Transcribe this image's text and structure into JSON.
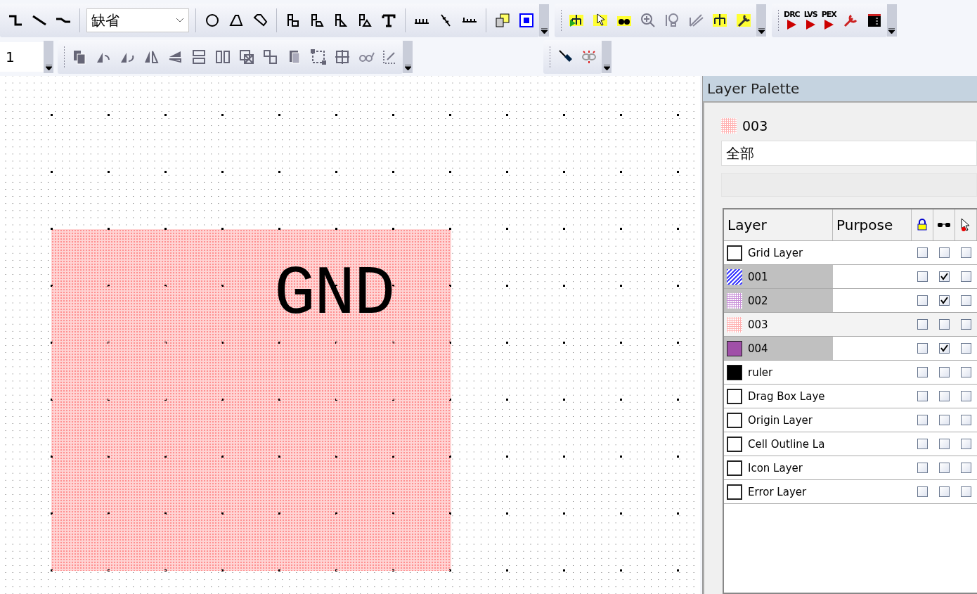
{
  "toolbar": {
    "style_combo": {
      "value": "缺省"
    },
    "width_field": {
      "value": "1"
    },
    "check_buttons": [
      {
        "label": "DRC"
      },
      {
        "label": "LVS"
      },
      {
        "label": "PEX"
      }
    ]
  },
  "canvas": {
    "label": "GND"
  },
  "layer_palette": {
    "title": "Layer Palette",
    "current_layer": {
      "name": "003",
      "kind": "dots",
      "color": "#ffb0b0"
    },
    "filter_combo": {
      "value": "全部"
    },
    "columns": [
      "Layer",
      "Purpose"
    ],
    "layers": [
      {
        "name": "Grid Layer",
        "kind": "outline",
        "color": "#ffffff",
        "selected": false,
        "locked": false,
        "visible": false,
        "selectable": false
      },
      {
        "name": "001",
        "kind": "hatch",
        "color": "#4040ff",
        "selected": true,
        "locked": false,
        "visible": true,
        "selectable": false
      },
      {
        "name": "002",
        "kind": "dots",
        "color": "#c890d8",
        "selected": true,
        "locked": false,
        "visible": true,
        "selectable": false
      },
      {
        "name": "003",
        "kind": "dots",
        "color": "#ffb0b0",
        "selected": false,
        "locked": false,
        "visible": false,
        "selectable": false
      },
      {
        "name": "004",
        "kind": "solid",
        "color": "#a050a8",
        "selected": true,
        "locked": false,
        "visible": true,
        "selectable": false
      },
      {
        "name": "ruler",
        "kind": "solid",
        "color": "#000000",
        "selected": false,
        "locked": false,
        "visible": false,
        "selectable": false
      },
      {
        "name": "Drag Box Laye",
        "kind": "outline",
        "color": "#ffffff",
        "selected": false,
        "locked": false,
        "visible": false,
        "selectable": false
      },
      {
        "name": "Origin Layer",
        "kind": "outline",
        "color": "#ffffff",
        "selected": false,
        "locked": false,
        "visible": false,
        "selectable": false
      },
      {
        "name": "Cell Outline La",
        "kind": "outline",
        "color": "#ffffff",
        "selected": false,
        "locked": false,
        "visible": false,
        "selectable": false
      },
      {
        "name": "Icon Layer",
        "kind": "outline",
        "color": "#ffffff",
        "selected": false,
        "locked": false,
        "visible": false,
        "selectable": false
      },
      {
        "name": "Error Layer",
        "kind": "outline",
        "color": "#ffffff",
        "selected": false,
        "locked": false,
        "visible": false,
        "selectable": false
      }
    ]
  }
}
